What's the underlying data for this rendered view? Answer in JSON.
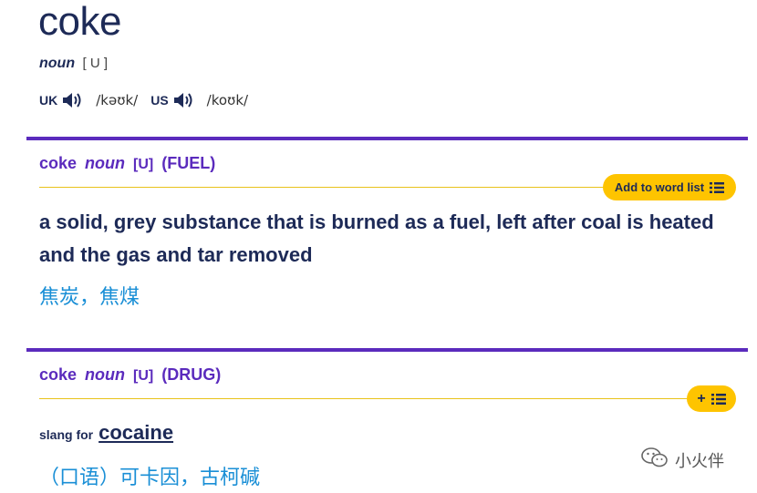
{
  "entry": {
    "headword": "coke",
    "pos": "noun",
    "grammar": "[ U ]",
    "pronunciations": [
      {
        "region": "UK",
        "ipa": "/kəʊk/"
      },
      {
        "region": "US",
        "ipa": "/koʊk/"
      }
    ]
  },
  "senses": [
    {
      "headword": "coke",
      "pos": "noun",
      "grammar": "[U]",
      "guideword": "(FUEL)",
      "button_label": "Add to word list",
      "definition": "a solid, grey substance that is burned as a fuel, left after coal is heated and the gas and tar removed",
      "translation": "焦炭，焦煤"
    },
    {
      "headword": "coke",
      "pos": "noun",
      "grammar": "[U]",
      "guideword": "(DRUG)",
      "button_label": "+",
      "slang_label": "slang for",
      "xref": "cocaine",
      "translation": "（口语）可卡因，古柯碱"
    }
  ],
  "watermark": {
    "text": "小火伴",
    "icon": "wechat-icon"
  },
  "colors": {
    "headword": "#1d2a57",
    "sense_accent": "#5b2bbd",
    "button_bg": "#fec400",
    "translation": "#1a8fd6"
  }
}
